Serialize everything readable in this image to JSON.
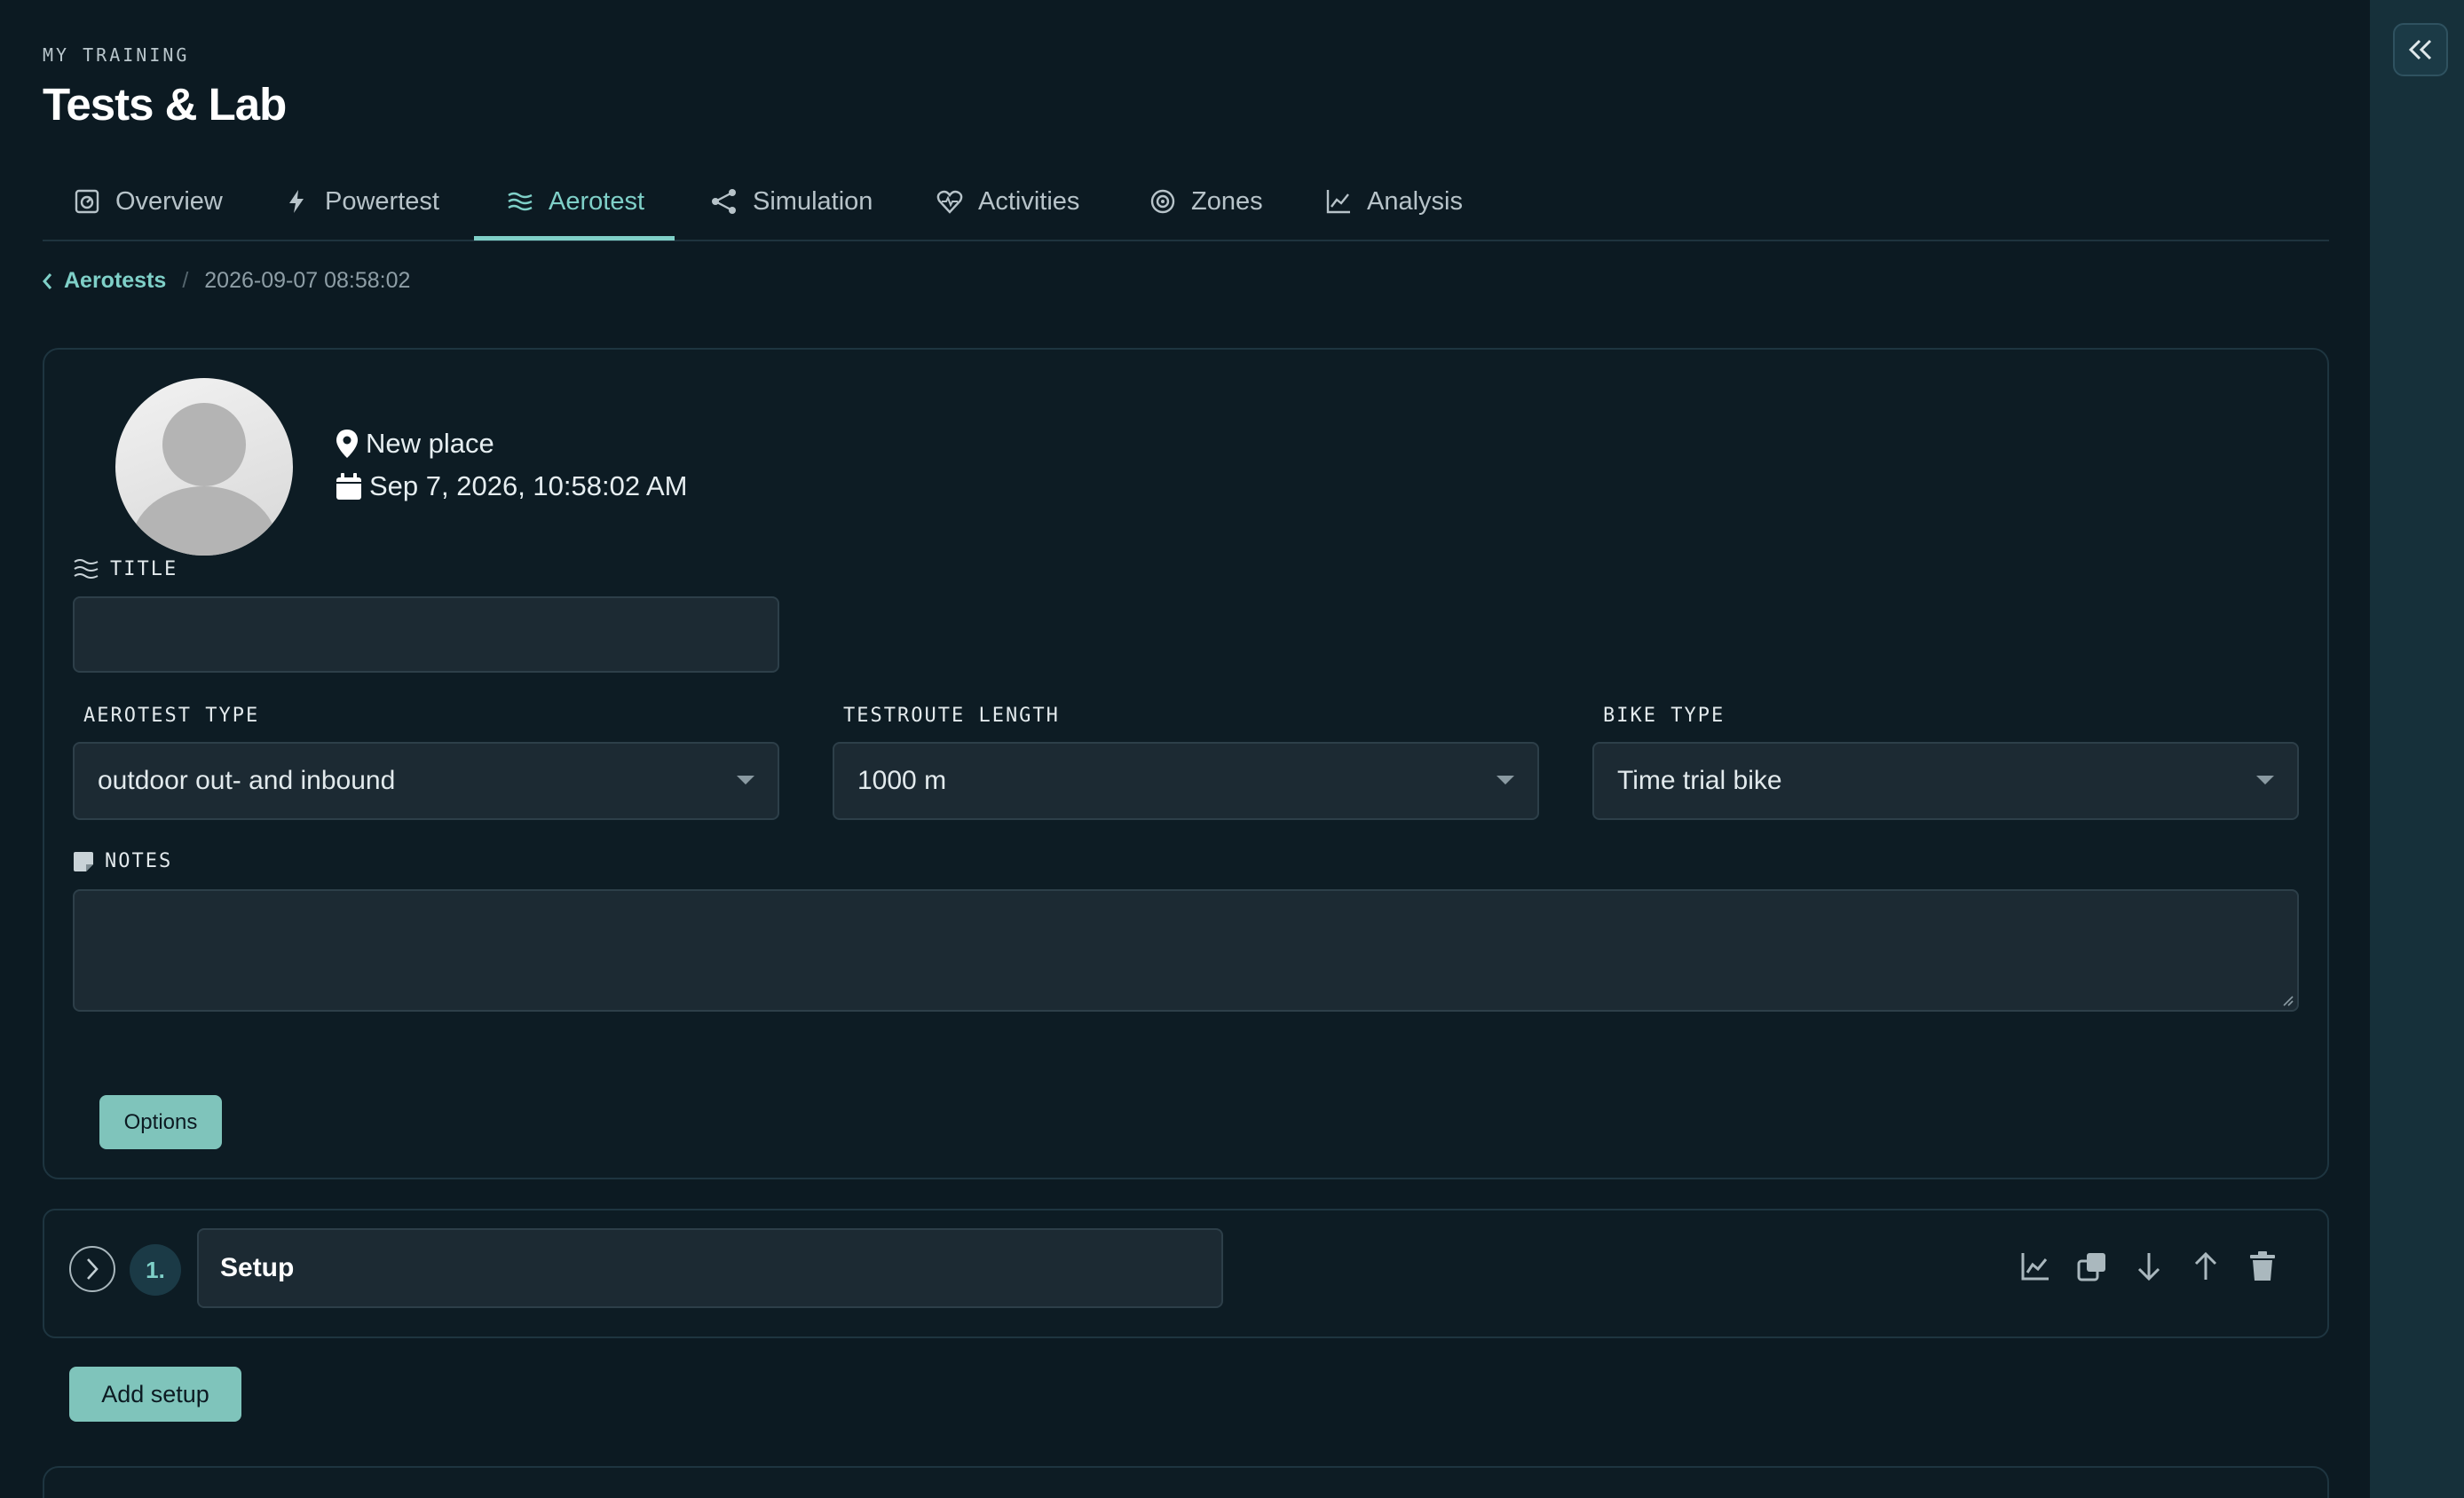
{
  "header": {
    "eyebrow": "MY TRAINING",
    "title": "Tests & Lab"
  },
  "tabs": [
    {
      "label": "Overview",
      "icon": "gauge-icon",
      "active": false
    },
    {
      "label": "Powertest",
      "icon": "lightning-icon",
      "active": false
    },
    {
      "label": "Aerotest",
      "icon": "wind-icon",
      "active": true
    },
    {
      "label": "Simulation",
      "icon": "share-nodes-icon",
      "active": false
    },
    {
      "label": "Activities",
      "icon": "heart-pulse-icon",
      "active": false
    },
    {
      "label": "Zones",
      "icon": "target-icon",
      "active": false
    },
    {
      "label": "Analysis",
      "icon": "line-chart-icon",
      "active": false
    }
  ],
  "breadcrumb": {
    "parent": "Aerotests",
    "separator": "/",
    "current": "2026-09-07 08:58:02"
  },
  "test": {
    "place": "New place",
    "datetime": "Sep 7, 2026, 10:58:02 AM"
  },
  "form": {
    "title_label": "TITLE",
    "title_value": "",
    "aerotest_type_label": "AEROTEST TYPE",
    "aerotest_type_value": "outdoor out- and inbound",
    "route_length_label": "TESTROUTE LENGTH",
    "route_length_value": "1000 m",
    "bike_type_label": "BIKE TYPE",
    "bike_type_value": "Time trial bike",
    "notes_label": "NOTES",
    "notes_value": "",
    "options_button": "Options"
  },
  "setups": [
    {
      "number": "1.",
      "name": "Setup"
    }
  ],
  "add_setup_button": "Add setup",
  "colors": {
    "background": "#0c1a22",
    "accent": "#7fd0c8",
    "button": "#7fc4bb",
    "input": "#1c2a33",
    "sidebar": "#16303a"
  }
}
